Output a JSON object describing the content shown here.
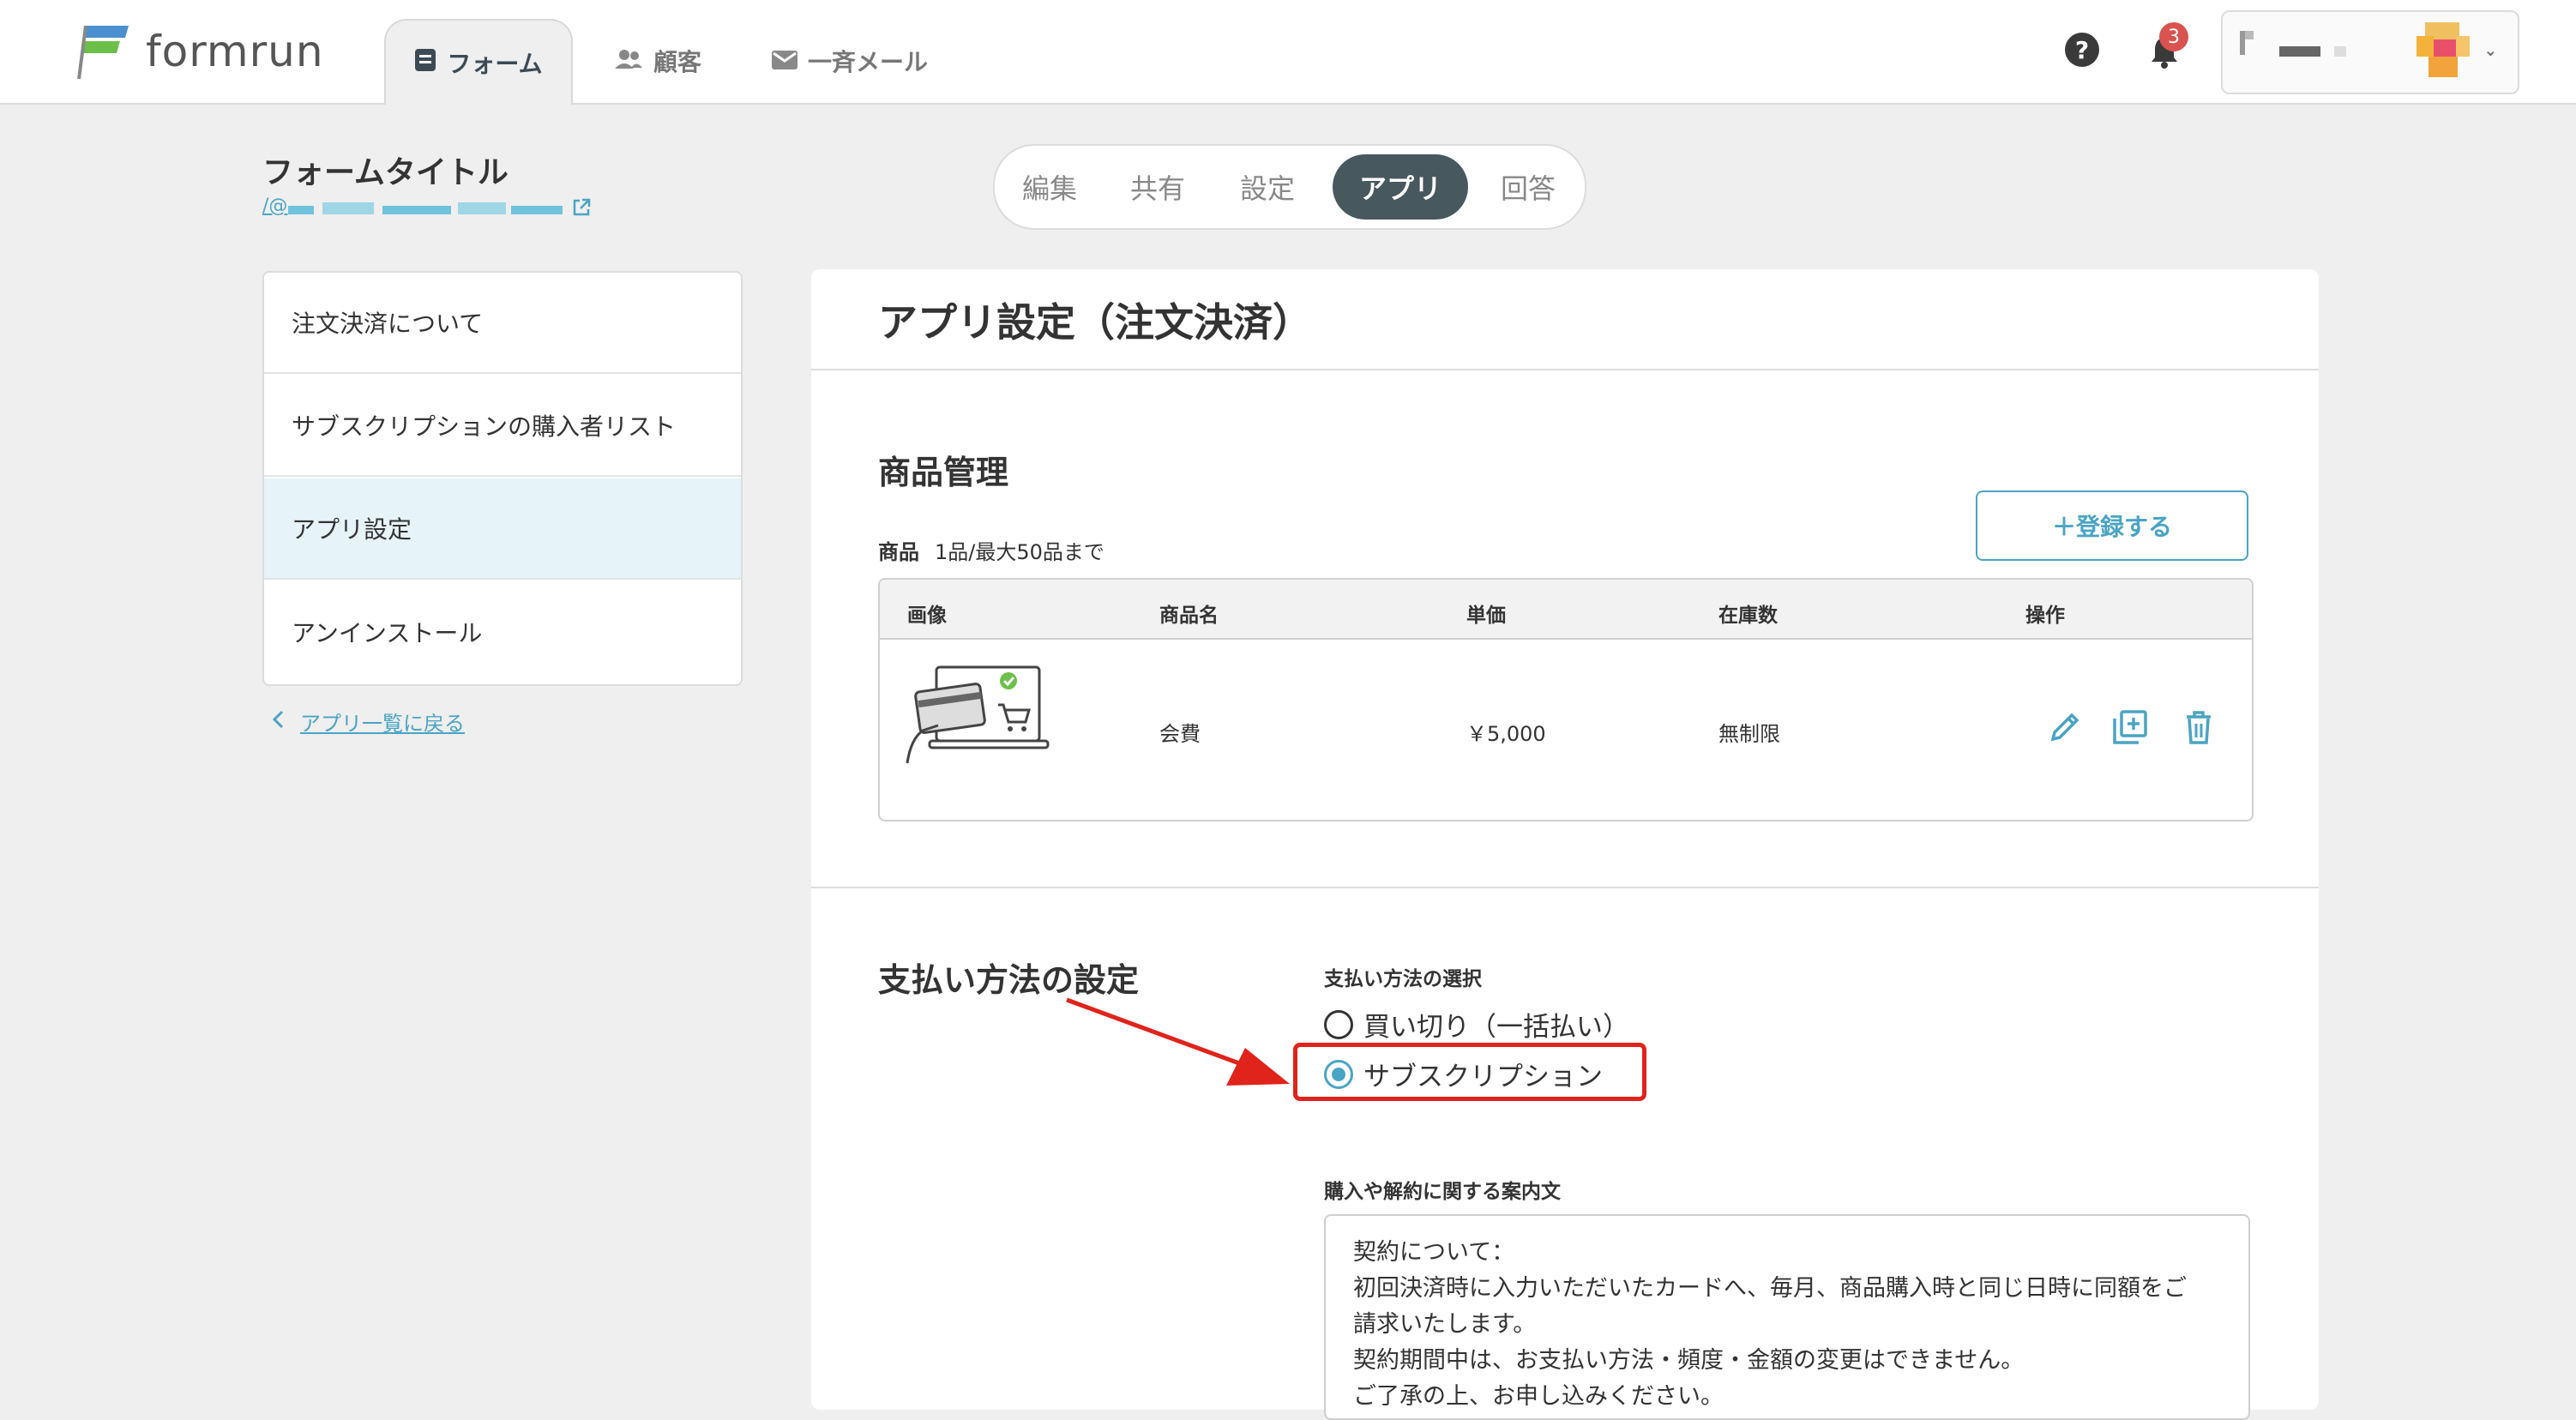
{
  "header": {
    "logo_text": "formrun",
    "nav": [
      {
        "label": "フォーム",
        "icon": "form-icon",
        "active": true
      },
      {
        "label": "顧客",
        "icon": "people-icon",
        "active": false
      },
      {
        "label": "一斉メール",
        "icon": "mail-icon",
        "active": false
      }
    ],
    "help_label": "?",
    "notification_count": "3"
  },
  "form": {
    "title": "フォームタイトル",
    "url_prefix": "/@"
  },
  "subtabs": [
    "編集",
    "共有",
    "設定",
    "アプリ",
    "回答"
  ],
  "sidebar": {
    "items": [
      {
        "label": "注文決済について"
      },
      {
        "label": "サブスクリプションの購入者リスト"
      },
      {
        "label": "アプリ設定"
      },
      {
        "label": "アンインストール"
      }
    ],
    "back_label": "アプリ一覧に戻る"
  },
  "main": {
    "title": "アプリ設定（注文決済）",
    "products": {
      "section_title": "商品管理",
      "caption_bold": "商品",
      "caption_text": "1品/最大50品まで",
      "register_label": "＋登録する",
      "columns": [
        "画像",
        "商品名",
        "単価",
        "在庫数",
        "操作"
      ],
      "rows": [
        {
          "image": "credit-card-checkout-illustration",
          "name": "会費",
          "price": "￥5,000",
          "stock": "無制限"
        }
      ]
    },
    "payment": {
      "section_title": "支払い方法の設定",
      "select_label": "支払い方法の選択",
      "options": [
        {
          "label": "買い切り（一括払い）",
          "checked": false
        },
        {
          "label": "サブスクリプション",
          "checked": true
        }
      ],
      "guide_label": "購入や解約に関する案内文",
      "guide_lines": [
        "契約について：",
        "初回決済時に入力いただいたカードへ、毎月、商品購入時と同じ日時に同額をご",
        "請求いたします。",
        "契約期間中は、お支払い方法・頻度・金額の変更はできません。",
        "ご了承の上、お申し込みください。"
      ]
    }
  },
  "colors": {
    "accent": "#4aa4c4",
    "highlight": "#e0231b",
    "active_tab": "#47585f"
  }
}
